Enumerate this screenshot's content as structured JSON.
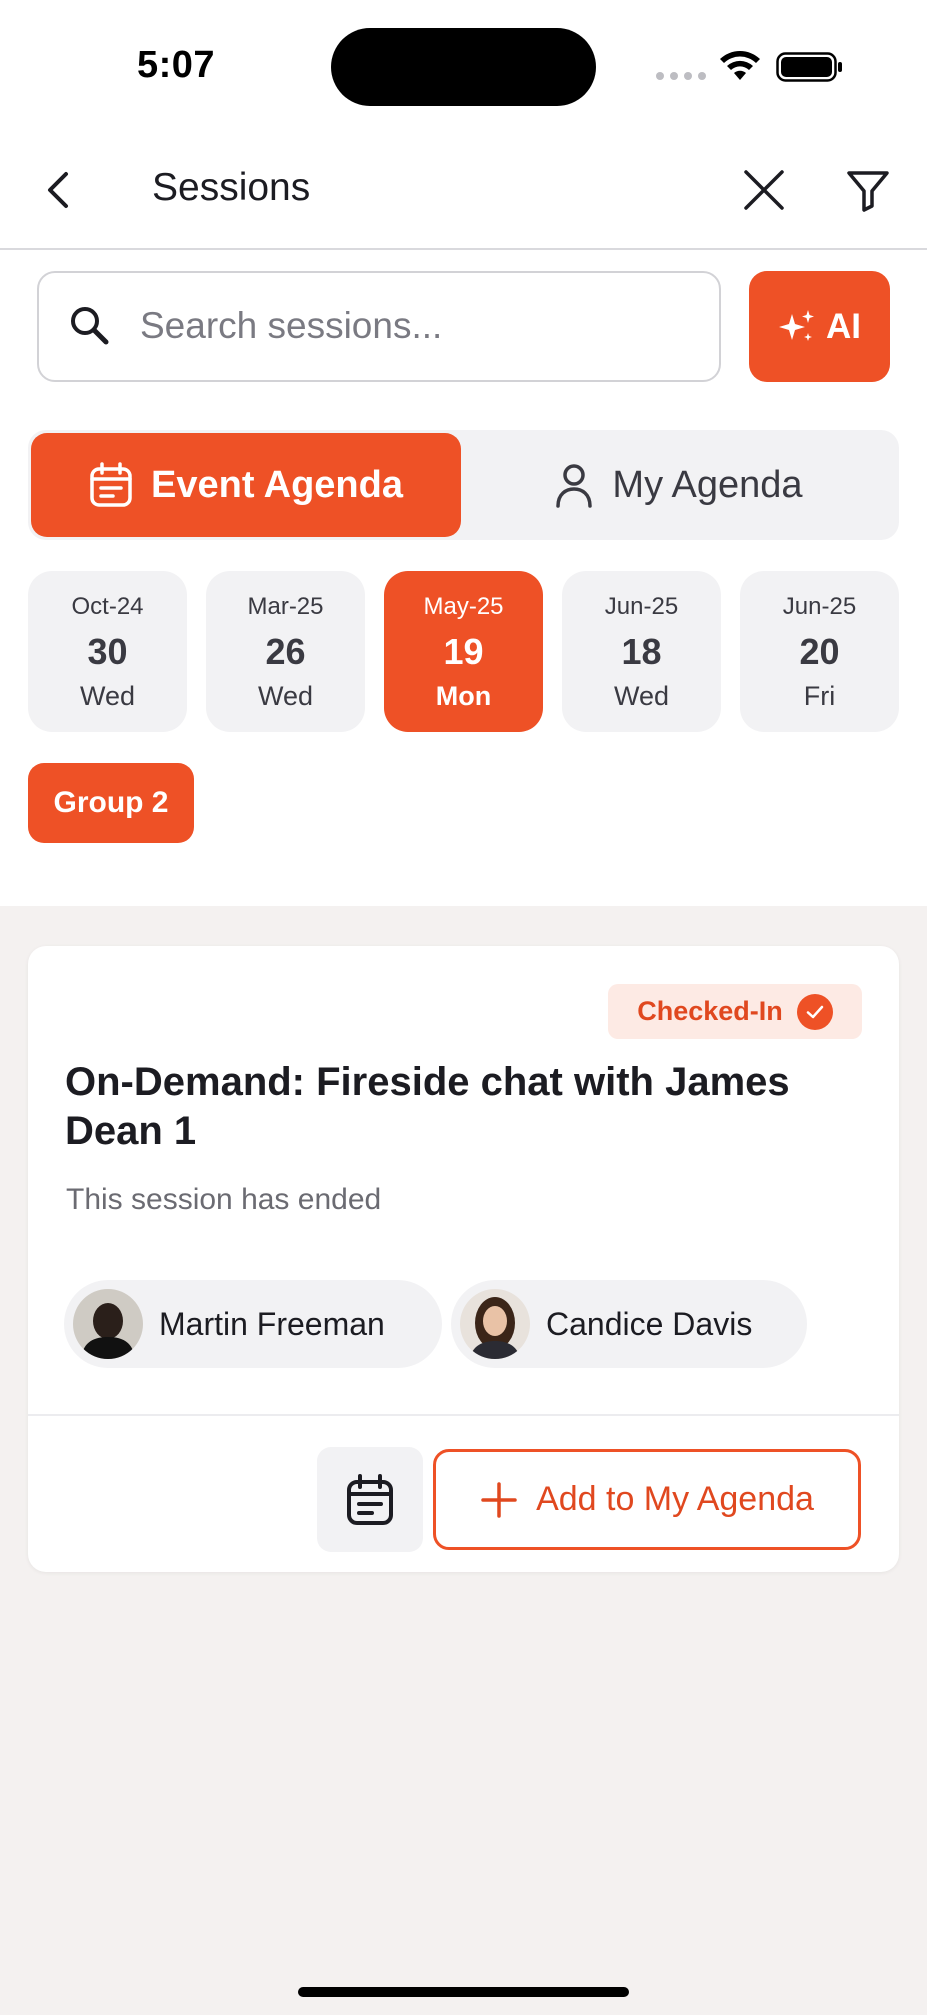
{
  "status_bar": {
    "time": "5:07"
  },
  "header": {
    "title": "Sessions",
    "icons": [
      "chevron-left-icon",
      "close-icon",
      "filter-icon"
    ]
  },
  "search": {
    "placeholder": "Search sessions...",
    "value": "",
    "ai_label": "AI"
  },
  "tabs": [
    {
      "label": "Event Agenda",
      "icon": "calendar-icon",
      "active": true
    },
    {
      "label": "My Agenda",
      "icon": "person-icon",
      "active": false
    }
  ],
  "dates": [
    {
      "month": "Oct-24",
      "day": "30",
      "weekday": "Wed",
      "active": false
    },
    {
      "month": "Mar-25",
      "day": "26",
      "weekday": "Wed",
      "active": false
    },
    {
      "month": "May-25",
      "day": "19",
      "weekday": "Mon",
      "active": true
    },
    {
      "month": "Jun-25",
      "day": "18",
      "weekday": "Wed",
      "active": false
    },
    {
      "month": "Jun-25",
      "day": "20",
      "weekday": "Fri",
      "active": false
    }
  ],
  "group": {
    "label": "Group 2"
  },
  "session": {
    "badge": "Checked-In",
    "title": "On-Demand: Fireside chat with James Dean 1",
    "status": "This session has ended",
    "speakers": [
      {
        "name": "Martin Freeman"
      },
      {
        "name": "Candice Davis"
      }
    ],
    "add_label": "Add to My Agenda"
  },
  "colors": {
    "accent": "#ee5126",
    "badge_bg": "#fdeae4",
    "chip_bg": "#f2f2f4",
    "list_bg": "#f4f1f0"
  }
}
